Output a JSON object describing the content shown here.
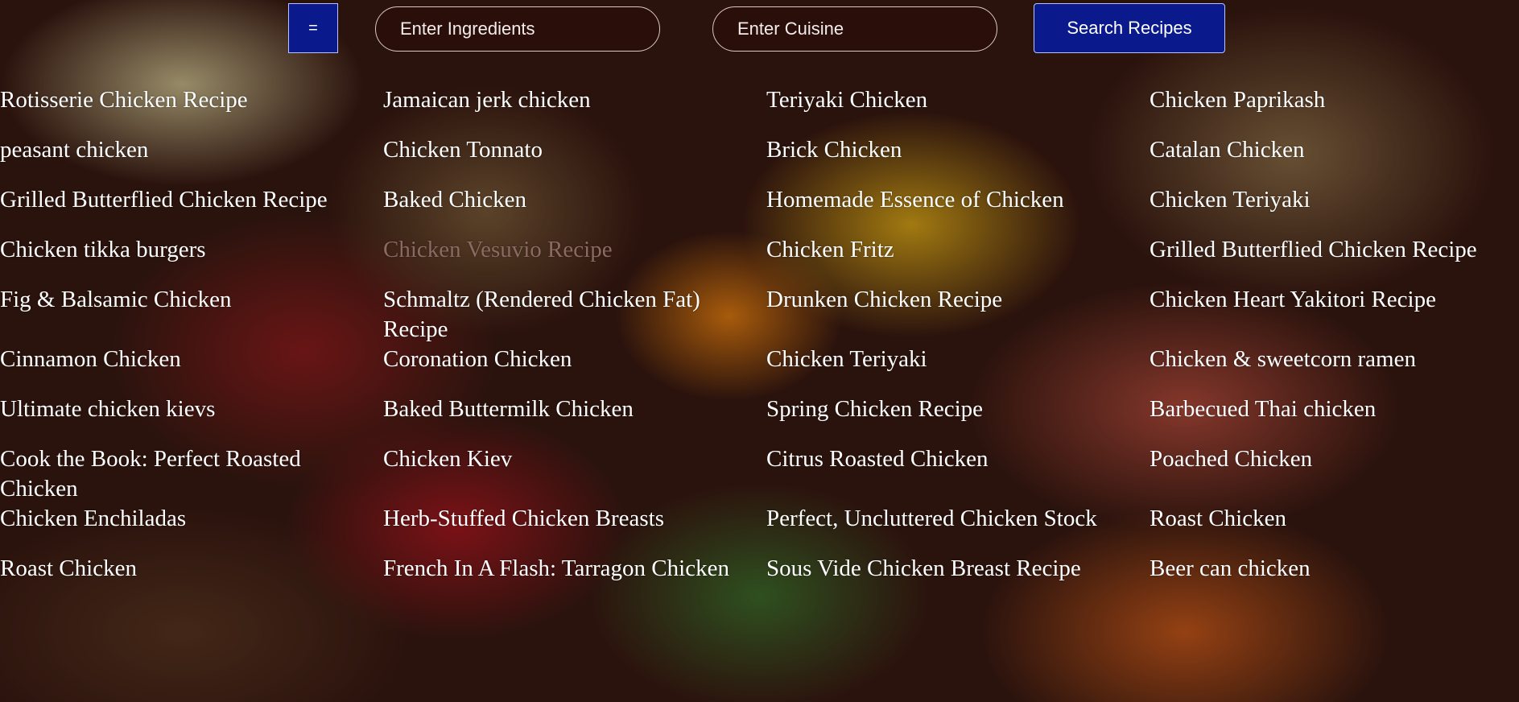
{
  "search": {
    "menu_label": "=",
    "ingredients_placeholder": "Enter Ingredients",
    "cuisine_placeholder": "Enter Cuisine",
    "button_label": "Search Recipes"
  },
  "recipes": [
    [
      "Rotisserie Chicken Recipe",
      "Jamaican jerk chicken",
      "Teriyaki Chicken",
      "Chicken Paprikash"
    ],
    [
      "peasant chicken",
      "Chicken Tonnato",
      "Brick Chicken",
      "Catalan Chicken"
    ],
    [
      "Grilled Butterflied Chicken Recipe",
      "Baked Chicken",
      "Homemade Essence of Chicken",
      "Chicken Teriyaki"
    ],
    [
      "Chicken tikka burgers",
      "Chicken Vesuvio Recipe",
      "Chicken Fritz",
      "Grilled Butterflied Chicken Recipe"
    ],
    [
      "Fig & Balsamic Chicken",
      "Schmaltz (Rendered Chicken Fat) Recipe",
      "Drunken Chicken Recipe",
      "Chicken Heart Yakitori Recipe"
    ],
    [
      "Cinnamon Chicken",
      "Coronation Chicken",
      "Chicken Teriyaki",
      "Chicken & sweetcorn ramen"
    ],
    [
      "Ultimate chicken kievs",
      "Baked Buttermilk Chicken",
      "Spring Chicken Recipe",
      "Barbecued Thai chicken"
    ],
    [
      "Cook the Book: Perfect Roasted Chicken",
      "Chicken Kiev",
      "Citrus Roasted Chicken",
      "Poached Chicken"
    ],
    [
      "Chicken Enchiladas",
      "Herb-Stuffed Chicken Breasts",
      "Perfect, Uncluttered Chicken Stock",
      "Roast Chicken"
    ],
    [
      "Roast Chicken",
      "French In A Flash: Tarragon Chicken",
      "Sous Vide Chicken Breast Recipe",
      "Beer can chicken"
    ]
  ]
}
